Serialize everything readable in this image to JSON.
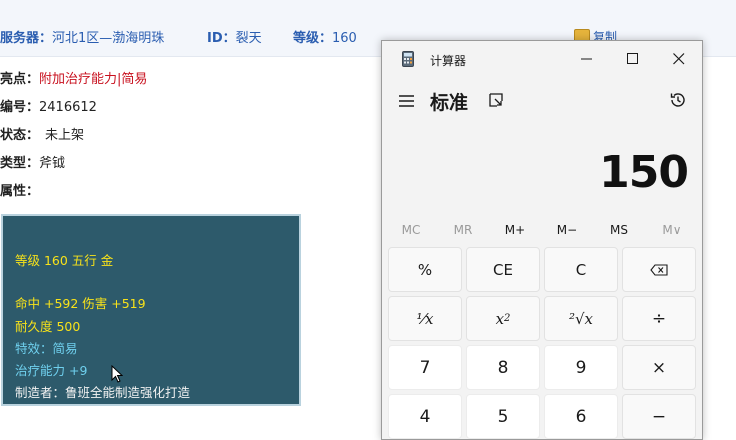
{
  "page": {
    "server_label": "服务器：",
    "server_value": "河北1区—渤海明珠",
    "id_label": "ID：",
    "id_value": "裂天",
    "level_label": "等级：",
    "level_value": "160",
    "copy_label": "复制",
    "fields": {
      "highlight_label": "亮点：",
      "highlight_value": "附加治疗能力|简易",
      "number_label": "编号：",
      "number_value": "2416612",
      "status_label": "状态：",
      "status_value": "未上架",
      "type_label": "类型：",
      "type_value": "斧钺",
      "attr_label": "属性："
    },
    "item_box": {
      "line1": "等级 160 五行 金",
      "line2": "命中 +592 伤害 +519",
      "line3": "耐久度 500",
      "line4": "特效：简易",
      "line5": "治疗能力 +9",
      "line6": "制造者：鲁班全能制造强化打造"
    }
  },
  "calculator": {
    "title": "计算器",
    "mode": "标准",
    "display": "150",
    "memory": [
      "MC",
      "MR",
      "M+",
      "M−",
      "MS",
      "M∨"
    ],
    "keys": {
      "percent": "%",
      "ce": "CE",
      "c": "C",
      "backspace": "⌫",
      "reciprocal": "¹⁄x",
      "square_base": "x",
      "square_exp": "2",
      "sqrt": "²√x",
      "divide": "÷",
      "n7": "7",
      "n8": "8",
      "n9": "9",
      "multiply": "×",
      "n4": "4",
      "n5": "5",
      "n6": "6",
      "minus": "−"
    },
    "icons": [
      "calculator-app-icon",
      "minimize-icon",
      "maximize-icon",
      "close-icon",
      "hamburger-menu-icon",
      "keep-on-top-icon",
      "history-icon"
    ]
  }
}
